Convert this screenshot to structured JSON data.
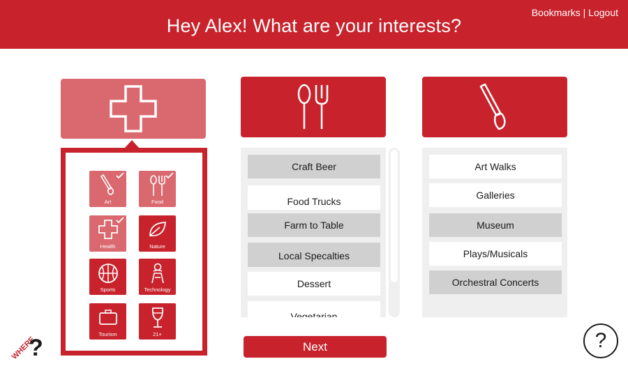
{
  "header": {
    "title": "Hey Alex! What are your interests?",
    "bookmarks": "Bookmarks",
    "separator": "|",
    "logout": "Logout"
  },
  "categories": {
    "health_icon": "cross-icon",
    "food_icon": "utensils-icon",
    "art_icon": "paintbrush-icon"
  },
  "tiles": [
    {
      "label": "Art",
      "icon": "paintbrush-icon",
      "selected": true
    },
    {
      "label": "Food",
      "icon": "utensils-icon",
      "selected": true
    },
    {
      "label": "Health",
      "icon": "cross-icon",
      "selected": true
    },
    {
      "label": "Nature",
      "icon": "leaf-icon",
      "selected": false
    },
    {
      "label": "Sports",
      "icon": "basketball-icon",
      "selected": false
    },
    {
      "label": "Technology",
      "icon": "technology-icon",
      "selected": false
    },
    {
      "label": "Tourism",
      "icon": "suitcase-icon",
      "selected": false
    },
    {
      "label": "21+",
      "icon": "wine-glass-icon",
      "selected": false
    }
  ],
  "food_list": [
    {
      "label": "Craft Beer",
      "selected": true
    },
    {
      "label": "Food Trucks",
      "selected": false
    },
    {
      "label": "Farm to Table",
      "selected": true
    },
    {
      "label": "Local Specalties",
      "selected": true
    },
    {
      "label": "Dessert",
      "selected": false
    },
    {
      "label": "Vegetarian",
      "selected": false
    }
  ],
  "art_list": [
    {
      "label": "Art Walks",
      "selected": false
    },
    {
      "label": "Galleries",
      "selected": false
    },
    {
      "label": "Museum",
      "selected": true
    },
    {
      "label": "Plays/Musicals",
      "selected": false
    },
    {
      "label": "Orchestral Concerts",
      "selected": true
    }
  ],
  "next_label": "Next",
  "logo_text": "WHERE",
  "help_label": "?",
  "colors": {
    "primary": "#c8232c",
    "faded": "#d9696f",
    "selected_row": "#d0d0d0",
    "panel_bg": "#efefef"
  }
}
